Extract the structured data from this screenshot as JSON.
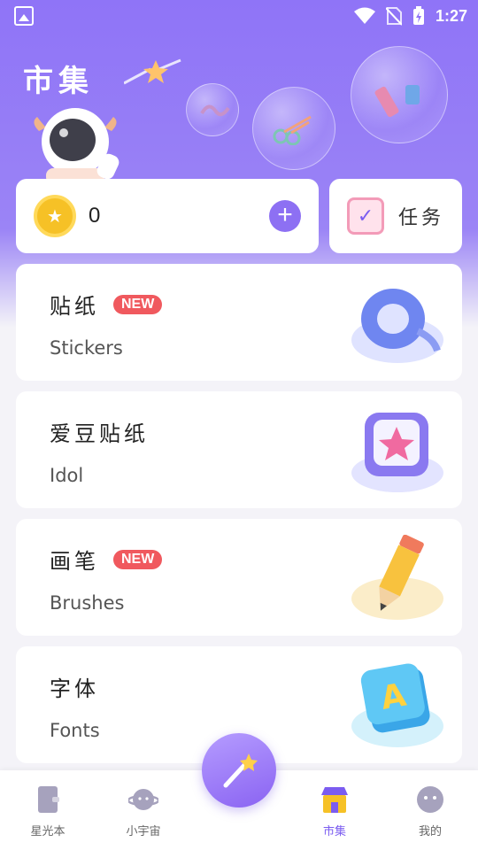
{
  "status_bar": {
    "time": "1:27"
  },
  "header": {
    "title": "市集"
  },
  "wallet": {
    "coins": "0"
  },
  "task": {
    "label": "任务"
  },
  "items": [
    {
      "name": "贴纸",
      "subtitle": "Stickers",
      "badge": "NEW"
    },
    {
      "name": "爱豆贴纸",
      "subtitle": "Idol",
      "badge": ""
    },
    {
      "name": "画笔",
      "subtitle": "Brushes",
      "badge": "NEW"
    },
    {
      "name": "字体",
      "subtitle": "Fonts",
      "badge": ""
    }
  ],
  "tabbar": {
    "tabs": [
      {
        "label": "星光本",
        "icon": "notebook-icon"
      },
      {
        "label": "小宇宙",
        "icon": "planet-icon"
      },
      {
        "label": "市集",
        "icon": "store-icon",
        "active": true
      },
      {
        "label": "我的",
        "icon": "profile-icon"
      }
    ],
    "fab_icon": "magic-wand-icon"
  },
  "colors": {
    "accent": "#8d70f3",
    "badge": "#f0595e",
    "hero": "#8f74f7"
  }
}
